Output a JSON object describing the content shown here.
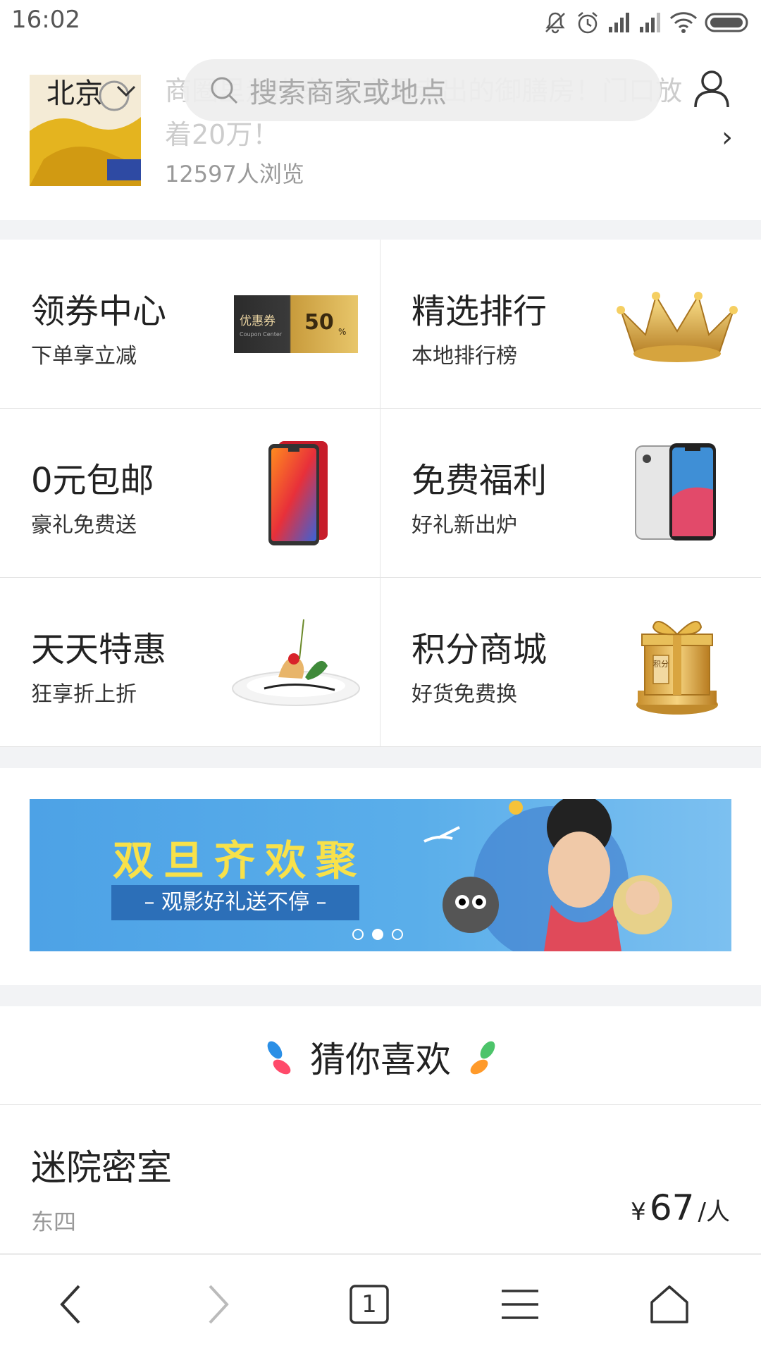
{
  "status_bar": {
    "time": "16:02"
  },
  "header": {
    "city": "北京",
    "search_placeholder": "搜索商家或地点"
  },
  "article": {
    "title": "商圈里走出来 故宫里走出的御膳房！门口放着20万！",
    "views": "12597人浏览"
  },
  "features": [
    {
      "title": "领券中心",
      "subtitle": "下单享立减",
      "icon": "coupon-icon"
    },
    {
      "title": "精选排行",
      "subtitle": "本地排行榜",
      "icon": "crown-icon"
    },
    {
      "title": "0元包邮",
      "subtitle": "豪礼免费送",
      "icon": "red-phone-icon"
    },
    {
      "title": "免费福利",
      "subtitle": "好礼新出炉",
      "icon": "iphone-icon"
    },
    {
      "title": "天天特惠",
      "subtitle": "狂享折上折",
      "icon": "dish-icon"
    },
    {
      "title": "积分商城",
      "subtitle": "好货免费换",
      "icon": "gift-icon"
    }
  ],
  "coupon_art": {
    "label": "优惠券",
    "sub": "Coupon Center",
    "value": "50",
    "unit": "%"
  },
  "gift_art": {
    "label": "积分"
  },
  "banner": {
    "title": "双旦齐欢聚",
    "subtitle": "– 观影好礼送不停 –",
    "active_slide": 2,
    "slides": 3
  },
  "recommend": {
    "title": "猜你喜欢",
    "items": [
      {
        "name": "迷院密室",
        "area": "东四",
        "currency": "¥",
        "price": "67",
        "unit": "/人"
      }
    ]
  },
  "bottom_nav": {
    "tab_count": "1"
  },
  "colors": {
    "gap": "#f2f3f5",
    "banner_bg": "#4da2e6",
    "banner_title": "#f8e14a",
    "text_primary": "#222222",
    "text_muted": "#999999"
  }
}
